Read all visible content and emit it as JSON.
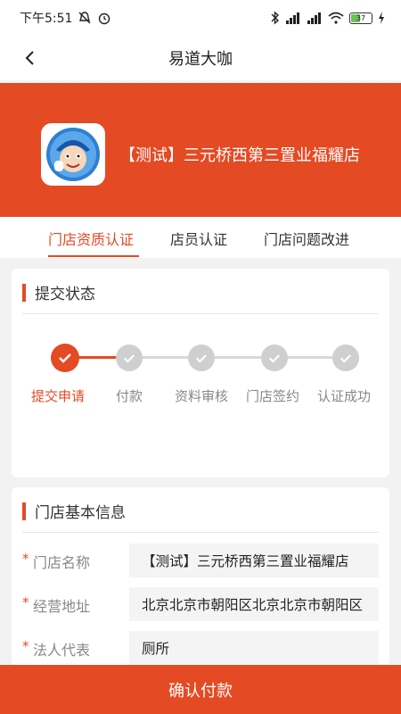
{
  "status_bar": {
    "time": "下午5:51",
    "battery": "37"
  },
  "nav": {
    "title": "易道大咖"
  },
  "store": {
    "name": "【测试】三元桥西第三置业福耀店"
  },
  "tabs": [
    {
      "label": "门店资质认证",
      "active": true
    },
    {
      "label": "店员认证",
      "active": false
    },
    {
      "label": "门店问题改进",
      "active": false
    }
  ],
  "submit_status": {
    "title": "提交状态",
    "steps": [
      {
        "label": "提交申请",
        "done": true
      },
      {
        "label": "付款",
        "done": false
      },
      {
        "label": "资料审核",
        "done": false
      },
      {
        "label": "门店签约",
        "done": false
      },
      {
        "label": "认证成功",
        "done": false
      }
    ]
  },
  "basic_info": {
    "title": "门店基本信息",
    "fields": [
      {
        "label": "门店名称",
        "value": "【测试】三元桥西第三置业福耀店",
        "required_mark": "*"
      },
      {
        "label": "经营地址",
        "value": "北京北京市朝阳区北京北京市朝阳区",
        "required_mark": "*"
      },
      {
        "label": "法人代表",
        "value": "厕所",
        "required_mark": "*"
      }
    ]
  },
  "footer": {
    "confirm_label": "确认付款"
  },
  "colors": {
    "accent": "#e44a24",
    "step_inactive": "#cfcfcf"
  }
}
